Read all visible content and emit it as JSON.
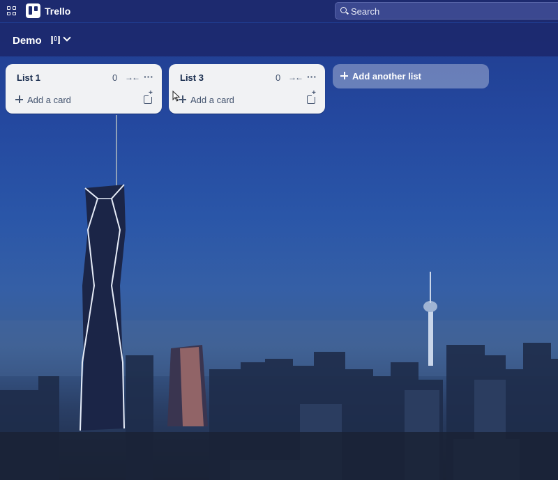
{
  "header": {
    "app_name": "Trello",
    "search_placeholder": "Search"
  },
  "board": {
    "title": "Demo"
  },
  "lists": [
    {
      "title": "List 1",
      "count": "0",
      "add_card_label": "Add a card"
    },
    {
      "title": "List 3",
      "count": "0",
      "add_card_label": "Add a card"
    }
  ],
  "add_list_label": "Add another list",
  "icons": {
    "apps": "apps-grid-icon",
    "logo": "trello-logo-icon",
    "search": "search-icon",
    "board_view": "board-view-icon",
    "chevron": "chevron-down-icon",
    "collapse": "collapse-icon",
    "more": "more-icon",
    "plus": "plus-icon",
    "template": "card-template-icon",
    "cursor": "mouse-cursor-icon"
  },
  "colors": {
    "header_bg": "#1d2a6f",
    "list_bg": "#f1f2f4",
    "list_text": "#172b4d"
  }
}
